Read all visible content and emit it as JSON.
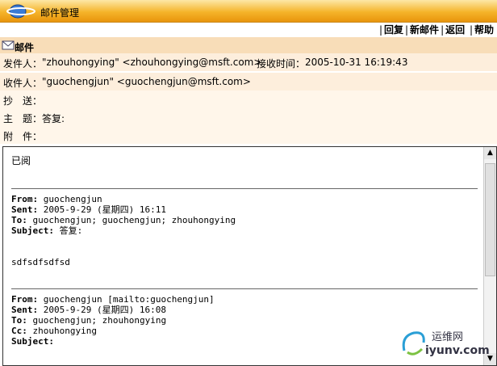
{
  "window": {
    "title": "邮件管理"
  },
  "toolbar": {
    "reply": "回复",
    "new_mail": "新邮件",
    "back": "返回",
    "help": "帮助"
  },
  "section": {
    "label": "邮件"
  },
  "header": {
    "from_label": "发件人：",
    "from_value": "\"zhouhongying\" <zhouhongying@msft.com>",
    "received_label": "接收时间：",
    "received_value": "2005-10-31 16:19:43",
    "to_label": "收件人：",
    "to_value": "\"guochengjun\" <guochengjun@msft.com>",
    "cc_label": "抄　送：",
    "cc_value": "",
    "subject_label": "主　题：",
    "subject_value": "答复:",
    "attach_label": "附　件：",
    "attach_value": ""
  },
  "body": {
    "greeting": "已阅",
    "m1_from": "From: ",
    "m1_from_v": "guochengjun",
    "m1_sent": "Sent: ",
    "m1_sent_v": "2005-9-29 (星期四) 16:11",
    "m1_to": "To: ",
    "m1_to_v": "guochengjun; guochengjun; zhouhongying",
    "m1_subj": "Subject: ",
    "m1_subj_v": "答复:",
    "m1_text": "sdfsdfsdfsd",
    "m2_from": "From: ",
    "m2_from_v": "guochengjun [mailto:guochengjun]",
    "m2_sent": "Sent: ",
    "m2_sent_v": "2005-9-29 (星期四) 16:08",
    "m2_to": "To: ",
    "m2_to_v": "guochengjun; zhouhongying",
    "m2_cc": "Cc: ",
    "m2_cc_v": "zhouhongying",
    "m2_subj": "Subject: "
  },
  "watermark": {
    "line1": "运维网",
    "line2": "iyunv.com"
  },
  "colors": {
    "titlebar": "#f5b42a",
    "section": "#f8ddb8",
    "row": "#fdeedc"
  }
}
